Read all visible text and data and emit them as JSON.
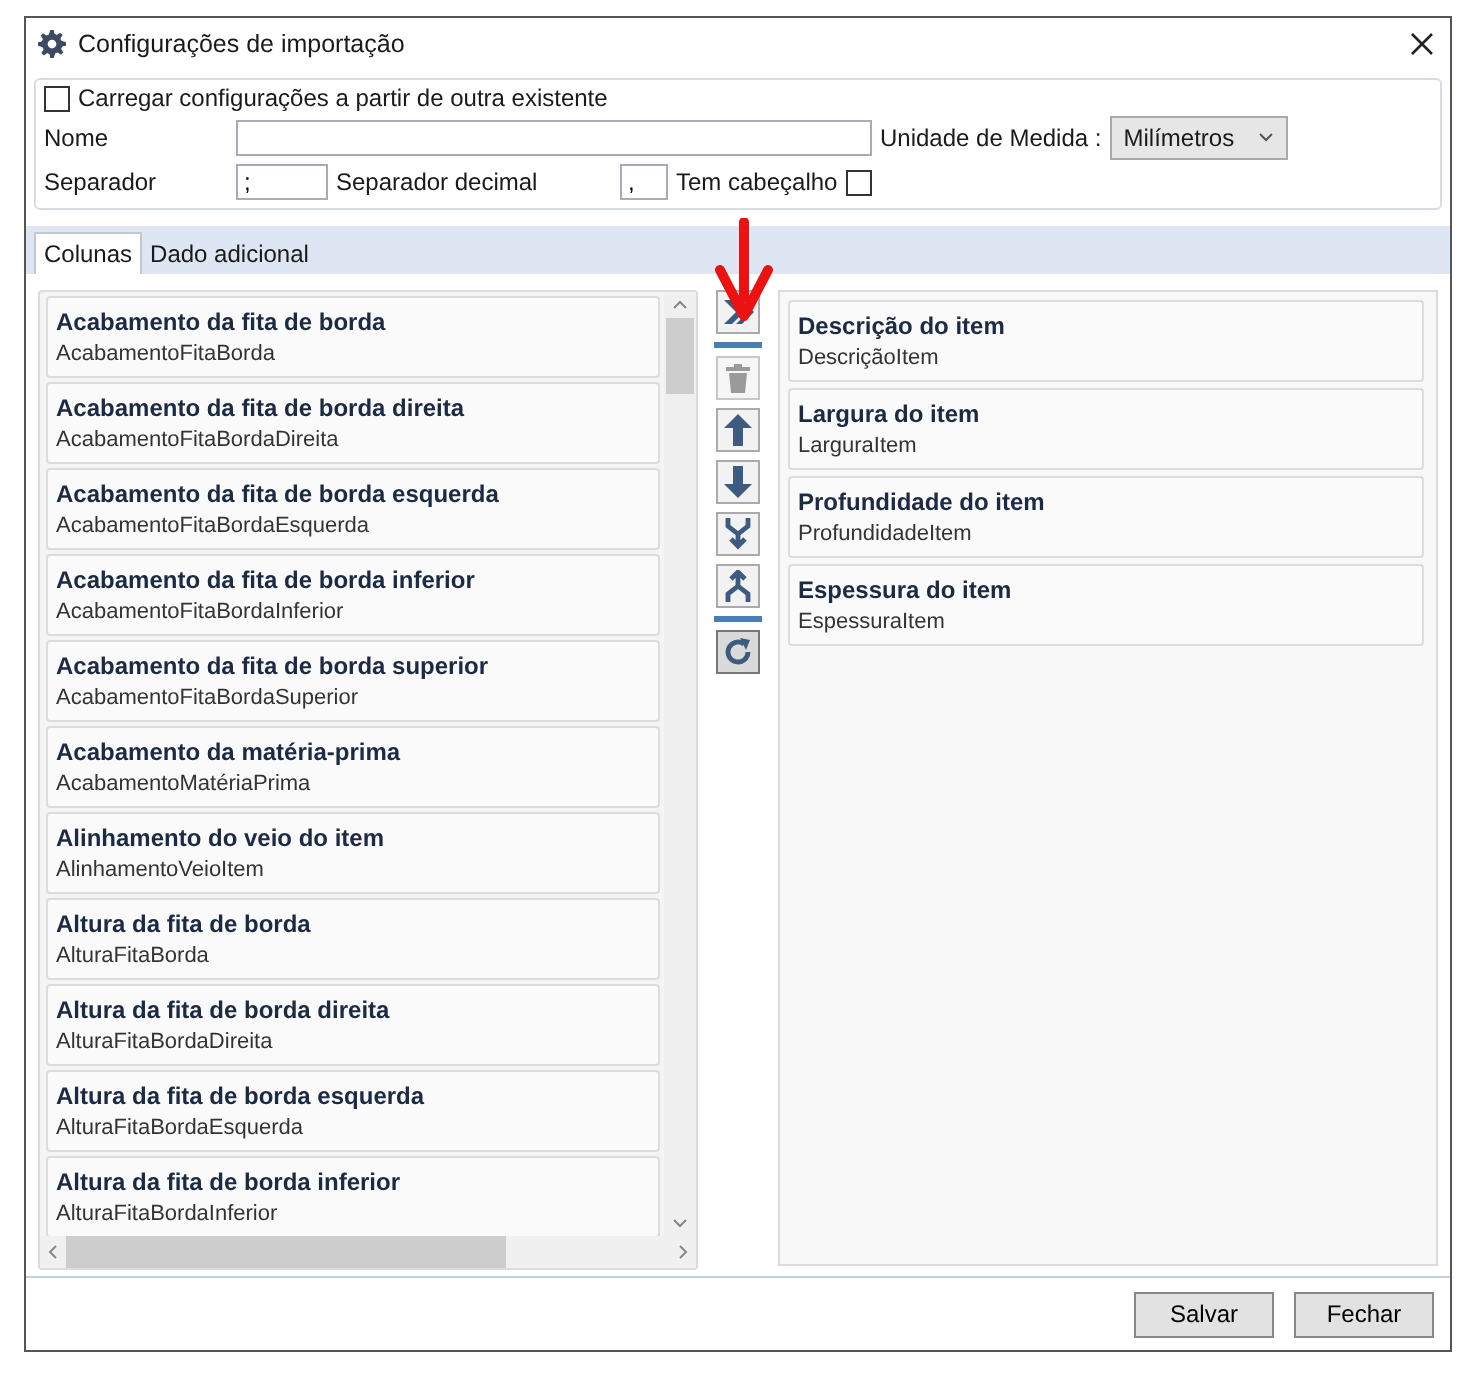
{
  "window": {
    "title": "Configurações de importação"
  },
  "load_existing": {
    "label": "Carregar configurações a partir de outra existente",
    "checked": false
  },
  "name_field": {
    "label": "Nome"
  },
  "unit": {
    "label": "Unidade de Medida :",
    "value": "Milímetros"
  },
  "separator": {
    "label": "Separador",
    "value": ";"
  },
  "decimal_separator": {
    "label": "Separador decimal",
    "value": ","
  },
  "has_header": {
    "label": "Tem cabeçalho",
    "checked": false
  },
  "tabs": [
    {
      "label": "Colunas",
      "selected": true
    },
    {
      "label": "Dado adicional",
      "selected": false
    }
  ],
  "available_columns": [
    {
      "title": "Acabamento da fita de borda",
      "field": "AcabamentoFitaBorda"
    },
    {
      "title": "Acabamento da fita de borda direita",
      "field": "AcabamentoFitaBordaDireita"
    },
    {
      "title": "Acabamento da fita de borda esquerda",
      "field": "AcabamentoFitaBordaEsquerda"
    },
    {
      "title": "Acabamento da fita de borda inferior",
      "field": "AcabamentoFitaBordaInferior"
    },
    {
      "title": "Acabamento da fita de borda superior",
      "field": "AcabamentoFitaBordaSuperior"
    },
    {
      "title": "Acabamento da matéria-prima",
      "field": "AcabamentoMatériaPrima"
    },
    {
      "title": "Alinhamento do veio do item",
      "field": "AlinhamentoVeioItem"
    },
    {
      "title": "Altura da fita de borda",
      "field": "AlturaFitaBorda"
    },
    {
      "title": "Altura da fita de borda direita",
      "field": "AlturaFitaBordaDireita"
    },
    {
      "title": "Altura da fita de borda esquerda",
      "field": "AlturaFitaBordaEsquerda"
    },
    {
      "title": "Altura da fita de borda inferior",
      "field": "AlturaFitaBordaInferior"
    }
  ],
  "tool_buttons": [
    {
      "kind": "add",
      "disabled": false
    },
    {
      "kind": "separator"
    },
    {
      "kind": "delete",
      "disabled": true
    },
    {
      "kind": "up",
      "disabled": false
    },
    {
      "kind": "down",
      "disabled": false
    },
    {
      "kind": "merge",
      "disabled": false
    },
    {
      "kind": "split",
      "disabled": false
    },
    {
      "kind": "separator"
    },
    {
      "kind": "refresh",
      "disabled": false
    }
  ],
  "selected_columns": [
    {
      "title": "Descrição do item",
      "field": "DescriçãoItem"
    },
    {
      "title": "Largura do item",
      "field": "LarguraItem"
    },
    {
      "title": "Profundidade do item",
      "field": "ProfundidadeItem"
    },
    {
      "title": "Espessura do item",
      "field": "EspessuraItem"
    }
  ],
  "buttons": [
    "Salvar",
    "Fechar"
  ]
}
